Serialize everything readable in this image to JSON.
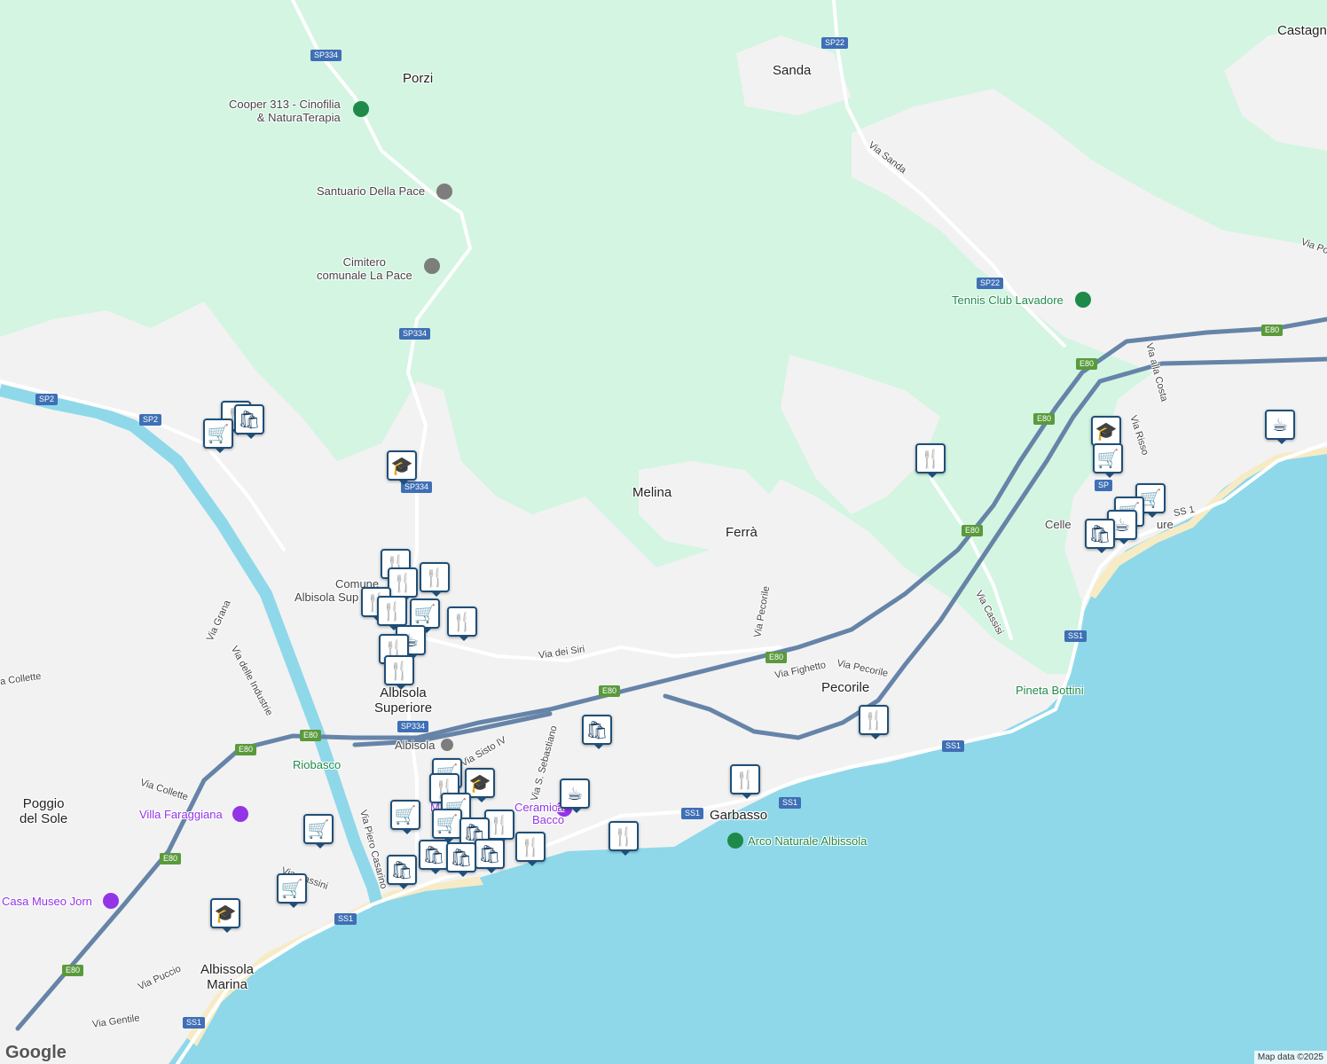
{
  "colors": {
    "sea": "#8ed8ea",
    "river": "#8ed8ea",
    "forest": "#d3f5e2",
    "urban": "#f2f2f2",
    "beach": "#f7ebc5",
    "road": "#ffffff",
    "highway": "#6684a8",
    "pin_border": "#1f4f78"
  },
  "places": {
    "porzi": "Porzi",
    "sanda": "Sanda",
    "castagna": "Castagn",
    "melina": "Melina",
    "ferra": "Ferrà",
    "pecorile": "Pecorile",
    "garbasso": "Garbasso",
    "albisola_superiore_1": "Albisola",
    "albisola_superiore_2": "Superiore",
    "poggio_1": "Poggio",
    "poggio_2": "del Sole",
    "albissola_marina_1": "Albissola",
    "albissola_marina_2": "Marina",
    "riobasco": "Riobasco",
    "celle": "Celle",
    "celle_ligure": "ure"
  },
  "pois": {
    "cooper_1": "Cooper 313 - Cinofilia",
    "cooper_2": "& NaturaTerapia",
    "santuario": "Santuario Della Pace",
    "cimitero_1": "Cimitero",
    "cimitero_2": "comunale La Pace",
    "tennis": "Tennis Club Lavadore",
    "pineta": "Pineta Bottini",
    "arco": "Arco Naturale Albissola",
    "villa": "Villa Faraggiana",
    "casa_museo": "Casa Museo Jorn",
    "comune_1": "Comune",
    "comune_2": "Albisola Sup",
    "albisola_station": "Albisola",
    "museo_1": "M",
    "museo_2": "Ceramica",
    "museo_3": "Bacco"
  },
  "roads": {
    "via_sanda": "Via Sanda",
    "via_pecorile_1": "Via Pecorile",
    "via_pecorile_2": "Via Pecorile",
    "via_fighetto": "Via Fighetto",
    "via_dei_siri": "Via dei Siri",
    "via_cassisi": "Via Cassisi",
    "via_alla_costa": "Via alla Costa",
    "via_risso": "Via Risso",
    "via_pos": "Via Pos",
    "via_grana": "Via Grana",
    "via_delle_industrie": "Via delle Industrie",
    "via_collette_1": "a Collette",
    "via_collette_2": "Via Collette",
    "via_sisto": "Via Sisto IV",
    "via_sebastiano": "Via S. Sebastiano",
    "via_piero": "Via Piero Casarino",
    "via_cassini": "Via Cassini",
    "via_puccio": "Via Puccio",
    "via_gentile": "Via Gentile",
    "ss1_lbl": "SS 1"
  },
  "shields": {
    "sp334_a": "SP334",
    "sp334_b": "SP334",
    "sp334_c": "SP334",
    "sp334_d": "SP334",
    "sp22_a": "SP22",
    "sp22_b": "SP22",
    "sp2": "SP2",
    "sp2b": "SP2",
    "e80_a": "E80",
    "e80_b": "E80",
    "e80_c": "E80",
    "e80_d": "E80",
    "e80_e": "E80",
    "e80_f": "E80",
    "e80_g": "E80",
    "e80_h": "E80",
    "e80_i": "E80",
    "e80_j": "E80",
    "ss1_a": "SS1",
    "ss1_b": "SS1",
    "ss1_c": "SS1",
    "ss1_d": "SS1",
    "ss1_e": "SS1",
    "ss1_f": "SS1",
    "sp_celle": "SP"
  },
  "icons": {
    "restaurant": "🍴",
    "shopping": "🛒",
    "store": "🛍",
    "cafe": "☕",
    "school": "🎓",
    "tree": "♣",
    "cross": "✝",
    "building": "⌂",
    "museum": "⌂",
    "train": "🚆"
  },
  "branding": {
    "logo": "Google",
    "attribution": "Map data ©2025"
  }
}
